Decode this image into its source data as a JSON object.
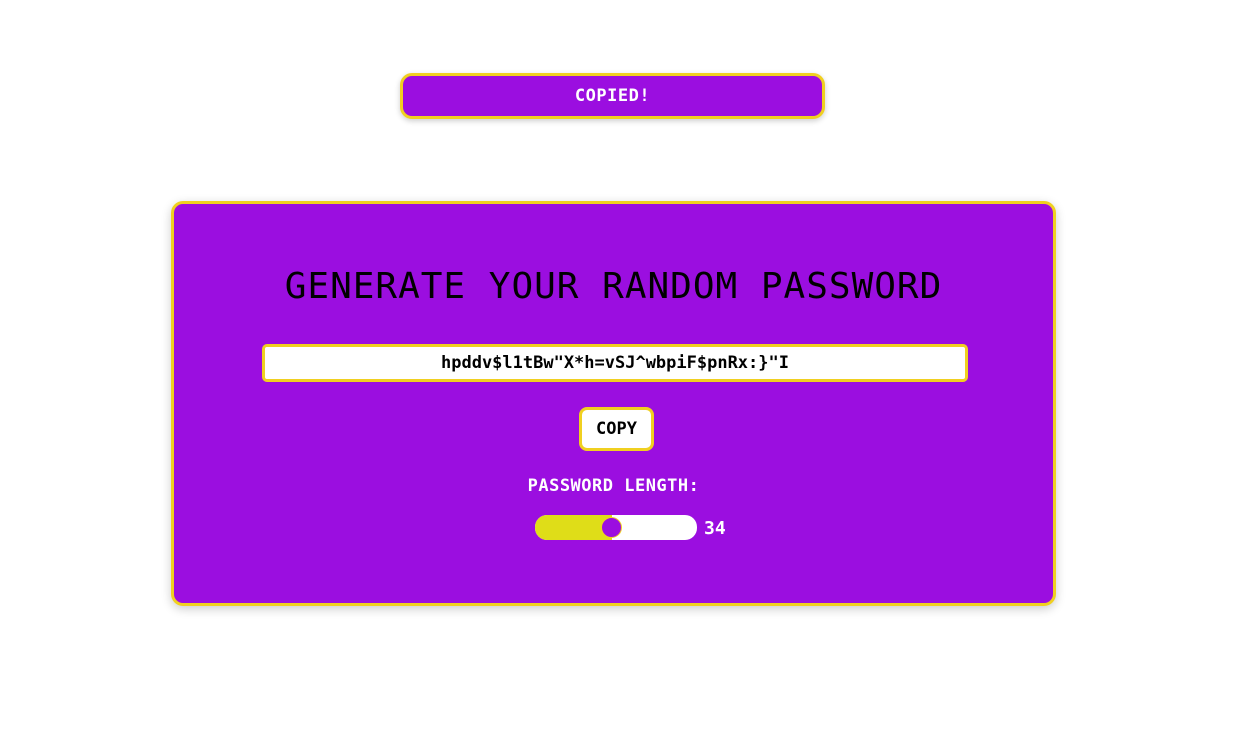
{
  "toast": {
    "text": "COPIED!"
  },
  "generator": {
    "title": "GENERATE YOUR RANDOM PASSWORD",
    "password": "hpddv$l1tBw\"X*h=vSJ^wbpiF$pnRx:}\"I",
    "copy_label": "COPY",
    "length_label": "PASSWORD LENGTH:",
    "length_value": "34",
    "length_fraction": 0.47
  },
  "colors": {
    "accent": "#9b0ee0",
    "border": "#f0d020",
    "slider_fill": "#dfdd18"
  }
}
